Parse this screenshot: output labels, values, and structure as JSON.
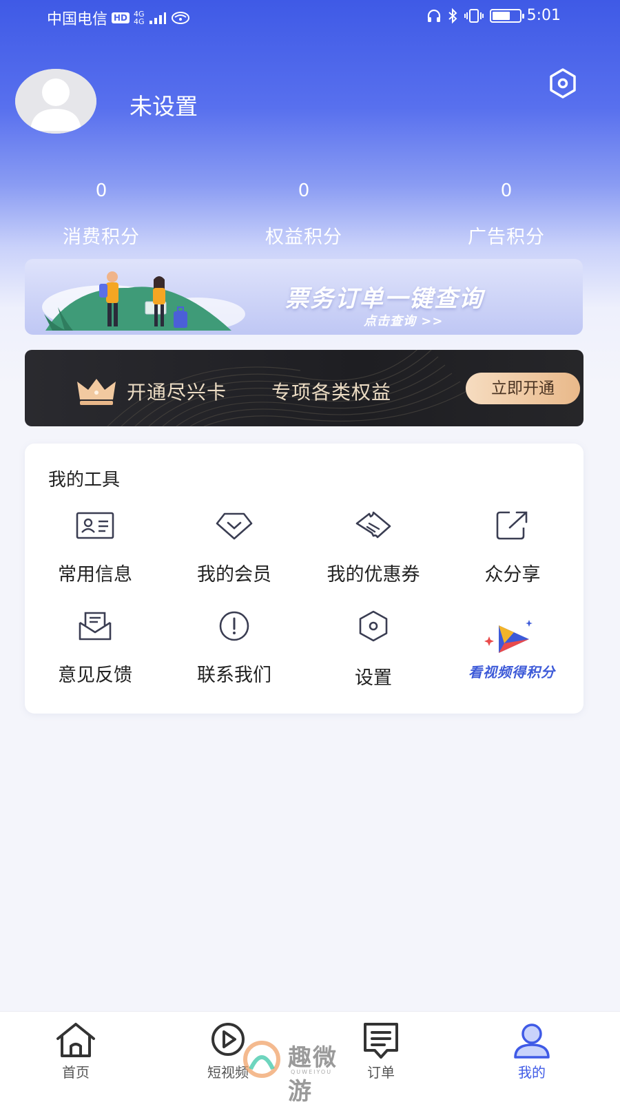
{
  "status_bar": {
    "carrier": "中国电信",
    "hd": "HD",
    "network_top": "4G",
    "network_bottom": "4G",
    "time": "5:01"
  },
  "profile": {
    "name": "未设置"
  },
  "stats": [
    {
      "value": "0",
      "label": "消费积分"
    },
    {
      "value": "0",
      "label": "权益积分"
    },
    {
      "value": "0",
      "label": "广告积分"
    }
  ],
  "ticket_banner": {
    "title": "票务订单一键查询",
    "subtitle": "点击查询 >>"
  },
  "vip_banner": {
    "text1": "开通尽兴卡",
    "text2": "专项各类权益",
    "button": "立即开通"
  },
  "tools": {
    "title": "我的工具",
    "items": [
      {
        "label": "常用信息",
        "icon": "id-card-icon"
      },
      {
        "label": "我的会员",
        "icon": "member-diamond-icon"
      },
      {
        "label": "我的优惠券",
        "icon": "coupon-icon"
      },
      {
        "label": "众分享",
        "icon": "share-icon"
      },
      {
        "label": "意见反馈",
        "icon": "feedback-envelope-icon"
      },
      {
        "label": "联系我们",
        "icon": "info-exclamation-icon"
      },
      {
        "label": "设置",
        "icon": "settings-hex-icon"
      },
      {
        "label": "看视频得积分",
        "icon": "video-play-icon"
      }
    ]
  },
  "bottom_nav": {
    "items": [
      {
        "label": "首页",
        "icon": "home-icon"
      },
      {
        "label": "短视频",
        "icon": "video-icon"
      },
      {
        "label": "订单",
        "icon": "orders-icon"
      },
      {
        "label": "我的",
        "icon": "profile-icon",
        "active": true
      }
    ]
  },
  "watermark": {
    "text": "趣微游",
    "sub": "QUWEIYOU"
  },
  "colors": {
    "accent": "#3f5ae6",
    "vip_gold": "#e9b98a",
    "background": "#f4f5fb"
  }
}
